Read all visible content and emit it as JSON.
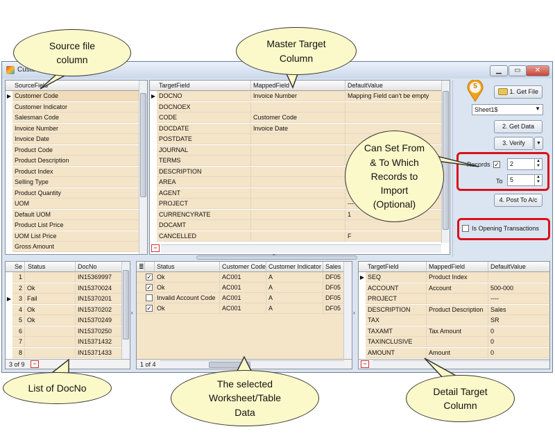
{
  "window": {
    "title": "Customer Im"
  },
  "bubbles": {
    "source": "Source file\ncolumn",
    "master": "Master Target\nColumn",
    "records": "Can Set From\n& To Which\nRecords to\nImport\n(Optional)",
    "docno": "List of DocNo",
    "selected": "The selected\nWorksheet/Table\nData",
    "detail": "Detail Target\nColumn"
  },
  "source_grid": {
    "header": "SourceField",
    "rows": [
      "Customer Code",
      "Customer Indicator",
      "Salesman Code",
      "Invoice Number",
      "Invoice Date",
      "Product Code",
      "Product Description",
      "Product Index",
      "Selling Type",
      "Product Quantity",
      "UOM",
      "Default UOM",
      "Product List Price",
      "UOM List Price",
      "Gross Amount"
    ]
  },
  "master_grid": {
    "headers": [
      "TargetField",
      "MappedField",
      "DefaultValue"
    ],
    "rows": [
      [
        "DOCNO",
        "Invoice Number",
        "Mapping Field can't be empty"
      ],
      [
        "DOCNOEX",
        "",
        ""
      ],
      [
        "CODE",
        "Customer Code",
        ""
      ],
      [
        "DOCDATE",
        "Invoice Date",
        ""
      ],
      [
        "POSTDATE",
        "",
        ""
      ],
      [
        "JOURNAL",
        "",
        ""
      ],
      [
        "TERMS",
        "",
        ""
      ],
      [
        "DESCRIPTION",
        "",
        ""
      ],
      [
        "AREA",
        "",
        ""
      ],
      [
        "AGENT",
        "",
        ""
      ],
      [
        "PROJECT",
        "",
        "---"
      ],
      [
        "CURRENCYRATE",
        "",
        "1"
      ],
      [
        "DOCAMT",
        "",
        ""
      ],
      [
        "CANCELLED",
        "",
        "F"
      ]
    ]
  },
  "right_panel": {
    "badge": "5",
    "get_file": "1. Get File",
    "sheet": "Sheet1$",
    "get_data": "2. Get Data",
    "verify": "3. Verify",
    "records_label": "Records",
    "records_from": "2",
    "to_label": "To",
    "records_to": "5",
    "post": "4. Post To A/c",
    "opening": "Is Opening Transactions"
  },
  "docno_grid": {
    "headers": [
      "Se",
      "Status",
      "DocNo"
    ],
    "rows": [
      [
        "1",
        "",
        "IN15369997"
      ],
      [
        "2",
        "Ok",
        "IN15370024"
      ],
      [
        "3",
        "Fail",
        "IN15370201"
      ],
      [
        "4",
        "Ok",
        "IN15370202"
      ],
      [
        "5",
        "Ok",
        "IN15370249"
      ],
      [
        "6",
        "",
        "IN15370250"
      ],
      [
        "7",
        "",
        "IN15371432"
      ],
      [
        "8",
        "",
        "IN15371433"
      ]
    ],
    "footer": "3 of 9"
  },
  "data_grid": {
    "headers": [
      "Status",
      "Customer Code",
      "Customer Indicator",
      "Sales"
    ],
    "rows": [
      {
        "checked": true,
        "cells": [
          "Ok",
          "AC001",
          "A",
          "DF05"
        ]
      },
      {
        "checked": true,
        "cells": [
          "Ok",
          "AC001",
          "A",
          "DF05"
        ]
      },
      {
        "checked": false,
        "cells": [
          "Invalid Account Code",
          "AC001",
          "A",
          "DF05"
        ]
      },
      {
        "checked": true,
        "cells": [
          "Ok",
          "AC001",
          "A",
          "DF05"
        ]
      }
    ],
    "footer": "1 of 4"
  },
  "detail_grid": {
    "headers": [
      "TargetField",
      "MappedField",
      "DefaultValue"
    ],
    "rows": [
      [
        "SEQ",
        "Product Index",
        ""
      ],
      [
        "ACCOUNT",
        "Account",
        "500-000"
      ],
      [
        "PROJECT",
        "",
        "----"
      ],
      [
        "DESCRIPTION",
        "Product Description",
        "Sales"
      ],
      [
        "TAX",
        "",
        "SR"
      ],
      [
        "TAXAMT",
        "Tax Amount",
        "0"
      ],
      [
        "TAXINCLUSIVE",
        "",
        "0"
      ],
      [
        "AMOUNT",
        "Amount",
        "0"
      ]
    ]
  }
}
